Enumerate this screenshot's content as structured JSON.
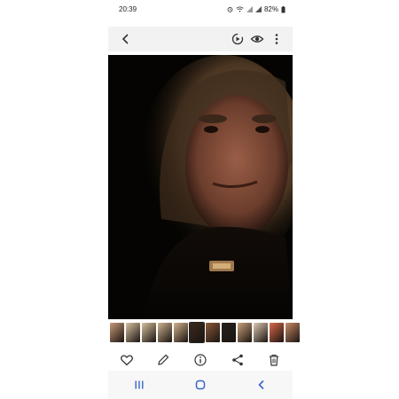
{
  "status_bar": {
    "time": "20:39",
    "battery": "82%",
    "icons": [
      "alarm-icon",
      "wifi-icon",
      "signal-icon",
      "signal-icon",
      "battery-icon"
    ]
  },
  "top_bar": {
    "back_icon": "chevron-left-icon",
    "right_icons": [
      "motion-photo-icon",
      "eye-icon",
      "more-vertical-icon"
    ]
  },
  "photo": {
    "description_icon": "photo-viewer-image"
  },
  "thumbnail_strip": {
    "count": 12,
    "selected_index": 5,
    "colors": [
      "#c89978",
      "#d9c2a2",
      "#d7c19d",
      "#cdb38f",
      "#d3b18b",
      "#3a2a20",
      "#8a5a3a",
      "#26211d",
      "#caa27a",
      "#e0c7b2",
      "#d96a4b",
      "#c98a66"
    ]
  },
  "action_bar": {
    "icons": [
      "heart-icon",
      "edit-icon",
      "info-icon",
      "share-icon",
      "delete-icon"
    ]
  },
  "nav_bar": {
    "icons": [
      "recents-icon",
      "home-icon",
      "back-icon"
    ]
  }
}
